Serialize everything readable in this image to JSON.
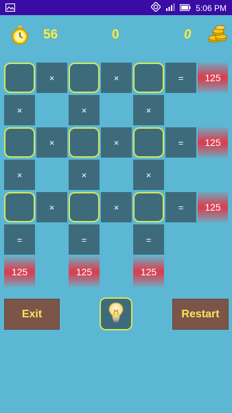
{
  "status_bar": {
    "time": "5:06 PM",
    "icons": [
      "image-icon",
      "sync-icon",
      "signal-icon",
      "battery-icon"
    ]
  },
  "hud": {
    "timer_value": "56",
    "score_value": "0",
    "coins_value": "0",
    "icons": [
      "stopwatch-icon",
      "coins-icon"
    ]
  },
  "grid": {
    "multiply_symbol": "×",
    "equals_symbol": "=",
    "row_targets": [
      "125",
      "125",
      "125"
    ],
    "column_targets": [
      "125",
      "125",
      "125"
    ]
  },
  "buttons": {
    "exit_label": "Exit",
    "restart_label": "Restart",
    "hint_icon": "lightbulb-icon"
  },
  "colors": {
    "background": "#5bb7d3",
    "status_bar": "#3a0ca3",
    "cell": "#3e6b7b",
    "slot_border": "#d7e75a",
    "hud_text": "#ffeb3b",
    "button": "#7a5548",
    "button_text": "#ffe45c",
    "target_red": "#dc3c4b"
  }
}
